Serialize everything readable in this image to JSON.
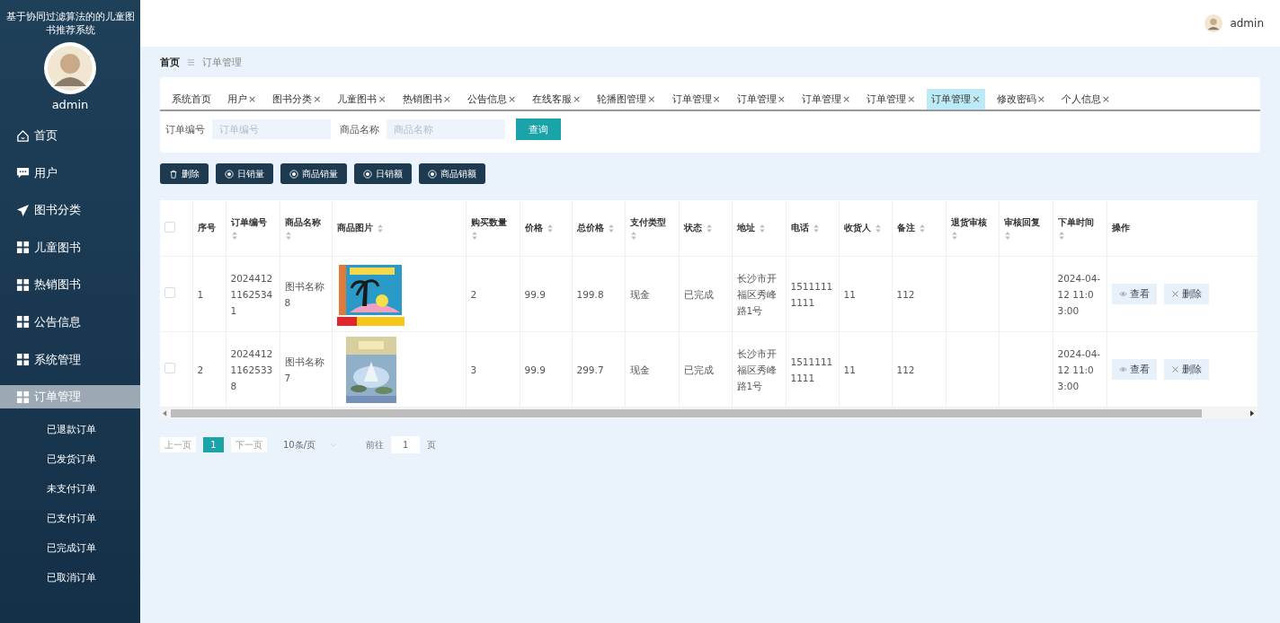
{
  "sidebar": {
    "title": "基于协同过滤算法的的儿童图书推荐系统",
    "username": "admin",
    "items": [
      {
        "label": "首页",
        "kind": "home",
        "selected": false
      },
      {
        "label": "用户",
        "kind": "chat",
        "selected": false
      },
      {
        "label": "图书分类",
        "kind": "plane",
        "selected": false
      },
      {
        "label": "儿童图书",
        "kind": "grid",
        "selected": false
      },
      {
        "label": "热销图书",
        "kind": "grid",
        "selected": false
      },
      {
        "label": "公告信息",
        "kind": "grid",
        "selected": false
      },
      {
        "label": "系统管理",
        "kind": "grid",
        "selected": false
      },
      {
        "label": "订单管理",
        "kind": "grid",
        "selected": true,
        "children": [
          {
            "label": "已退款订单"
          },
          {
            "label": "已发货订单"
          },
          {
            "label": "未支付订单"
          },
          {
            "label": "已支付订单"
          },
          {
            "label": "已完成订单"
          },
          {
            "label": "已取消订单"
          }
        ]
      }
    ]
  },
  "header": {
    "username": "admin"
  },
  "breadcrumb": [
    "首页",
    "订单管理"
  ],
  "tabs": [
    {
      "label": "系统首页",
      "closable": false,
      "selected": false
    },
    {
      "label": "用户",
      "closable": true,
      "selected": false
    },
    {
      "label": "图书分类",
      "closable": true,
      "selected": false
    },
    {
      "label": "儿童图书",
      "closable": true,
      "selected": false
    },
    {
      "label": "热销图书",
      "closable": true,
      "selected": false
    },
    {
      "label": "公告信息",
      "closable": true,
      "selected": false
    },
    {
      "label": "在线客服",
      "closable": true,
      "selected": false
    },
    {
      "label": "轮播图管理",
      "closable": true,
      "selected": false
    },
    {
      "label": "订单管理",
      "closable": true,
      "selected": false
    },
    {
      "label": "订单管理",
      "closable": true,
      "selected": false
    },
    {
      "label": "订单管理",
      "closable": true,
      "selected": false
    },
    {
      "label": "订单管理",
      "closable": true,
      "selected": false
    },
    {
      "label": "订单管理",
      "closable": true,
      "selected": true
    },
    {
      "label": "修改密码",
      "closable": true,
      "selected": false
    },
    {
      "label": "个人信息",
      "closable": true,
      "selected": false
    }
  ],
  "close_glyph": "×",
  "search": {
    "fields": [
      {
        "label": "订单编号",
        "placeholder": "订单编号"
      },
      {
        "label": "商品名称",
        "placeholder": "商品名称"
      }
    ],
    "button": "查询"
  },
  "actions": [
    {
      "label": "删除",
      "kind": "delete"
    },
    {
      "label": "日销量",
      "kind": "chart"
    },
    {
      "label": "商品销量",
      "kind": "chart"
    },
    {
      "label": "日销额",
      "kind": "chart"
    },
    {
      "label": "商品销额",
      "kind": "chart"
    }
  ],
  "table": {
    "select_all": {
      "checked": false
    },
    "columns": [
      {
        "label": "序号",
        "sortable": false
      },
      {
        "label": "订单编号",
        "sortable": true
      },
      {
        "label": "商品名称",
        "sortable": true
      },
      {
        "label": "商品图片",
        "sortable": true
      },
      {
        "label": "购买数量",
        "sortable": true
      },
      {
        "label": "价格",
        "sortable": true
      },
      {
        "label": "总价格",
        "sortable": true
      },
      {
        "label": "支付类型",
        "sortable": true
      },
      {
        "label": "状态",
        "sortable": true
      },
      {
        "label": "地址",
        "sortable": true
      },
      {
        "label": "电话",
        "sortable": true
      },
      {
        "label": "收货人",
        "sortable": true
      },
      {
        "label": "备注",
        "sortable": true
      },
      {
        "label": "退货审核",
        "sortable": true
      },
      {
        "label": "审核回复",
        "sortable": true
      },
      {
        "label": "下单时间",
        "sortable": true
      },
      {
        "label": "操作",
        "sortable": false
      }
    ],
    "rows": [
      {
        "checked": false,
        "cells": [
          "1",
          "202441211625341",
          "图书名称8",
          {
            "kind": "picture"
          },
          "2",
          "99.9",
          "199.8",
          "现金",
          "已完成",
          "长沙市开福区秀峰路1号",
          "15111111111",
          "11",
          "112",
          "",
          "",
          "2024-04-12 11:03:00"
        ],
        "buttons": [
          "查看",
          "删除"
        ]
      },
      {
        "checked": false,
        "cells": [
          "2",
          "202441211625338",
          "图书名称7",
          {
            "kind": "picture"
          },
          "3",
          "99.9",
          "299.7",
          "现金",
          "已完成",
          "长沙市开福区秀峰路1号",
          "15111111111",
          "11",
          "112",
          "",
          "",
          "2024-04-12 11:03:00"
        ],
        "buttons": [
          "查看",
          "删除"
        ]
      }
    ]
  },
  "pagination": {
    "prev": "上一页",
    "pages": [
      {
        "label": "1",
        "selected": true
      }
    ],
    "next": "下一页",
    "page_size": "10条/页",
    "goto_label": "前往",
    "goto_value": "1",
    "goto_suffix": "页"
  }
}
